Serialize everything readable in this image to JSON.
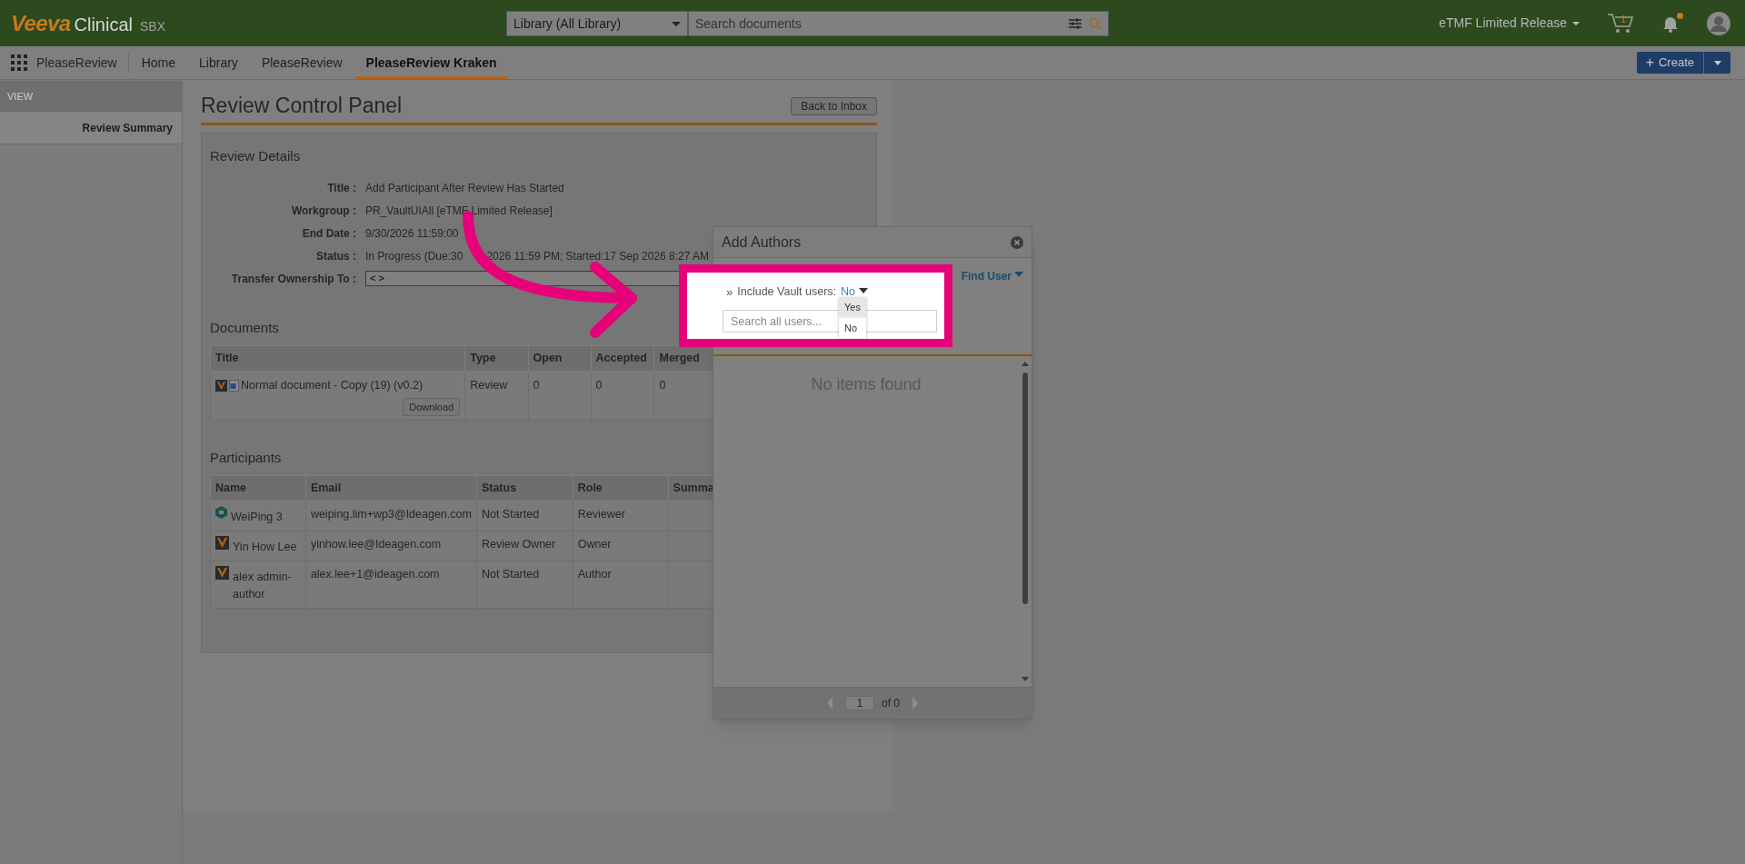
{
  "header": {
    "brand": "Veeva",
    "product": "Clinical",
    "environment": "SBX",
    "search_scope": "Library (All Library)",
    "search": {
      "placeholder": "Search documents"
    },
    "vault_name": "eTMF Limited Release",
    "cart_count": "1",
    "notification_dot": true
  },
  "nav": {
    "create_icon": "+",
    "app_name": "PleaseReview",
    "tabs": [
      {
        "label": "Home",
        "selected": false
      },
      {
        "label": "Library",
        "selected": false
      },
      {
        "label": "PleaseReview",
        "selected": false
      },
      {
        "label": "PleaseReview Kraken",
        "selected": true
      }
    ],
    "create_button": "Create"
  },
  "sidebar": {
    "heading": "VIEW",
    "items": [
      {
        "label": "Review Summary",
        "selected": true
      }
    ]
  },
  "page": {
    "title": "Review Control Panel",
    "back_button": "Back to Inbox"
  },
  "review_details": {
    "heading": "Review Details",
    "fields": [
      {
        "label": "Title :",
        "value": "Add Participant After Review Has Started",
        "kind": "text"
      },
      {
        "label": "Workgroup :",
        "value": "PR_VaultUIAll [eTMF Limited Release]",
        "kind": "text"
      },
      {
        "label": "End Date :",
        "value": "9/30/2026 11:59:00",
        "kind": "text"
      },
      {
        "label": "Status :",
        "value": "In Progress (Due:30",
        "value_after": "2026 11:59 PM; Started:17 Sep 2026 8:27 AM",
        "kind": "text"
      },
      {
        "label": "Transfer Ownership To :",
        "value": "< >",
        "kind": "select"
      }
    ]
  },
  "documents": {
    "heading": "Documents",
    "columns": [
      "Title",
      "Type",
      "Open",
      "Accepted",
      "Merged"
    ],
    "rows": [
      {
        "button": "Download",
        "cells": [
          "Normal document - Copy (19) (v0.2)",
          "Review",
          "0",
          "0",
          "0"
        ]
      }
    ]
  },
  "participants": {
    "heading": "Participants",
    "columns": [
      "Name",
      "Email",
      "Status",
      "Role",
      "Summa"
    ],
    "rows": [
      {
        "name": "WeiPing 3",
        "kind": "external",
        "email": "weiping.lim+wp3@Ideagen.com",
        "status": "Not Started",
        "role": "Reviewer"
      },
      {
        "name": "Yin How Lee",
        "kind": "vault",
        "email": "yinhow.lee@Ideagen.com",
        "status": "Review Owner",
        "role": "Owner"
      },
      {
        "name": "alex admin-author",
        "kind": "vault",
        "email": "alex.lee+1@ideagen.com",
        "status": "Not Started",
        "role": "Author"
      }
    ]
  },
  "dialog": {
    "title": "Add Authors",
    "find_user": "Find User",
    "filter_marker": "»",
    "filter_label": "Include Vault users:",
    "filter_value": "No",
    "filter_options": [
      {
        "label": "Yes",
        "highlighted": true
      },
      {
        "label": "No",
        "highlighted": false
      }
    ],
    "search": {
      "placeholder": "Search all users..."
    },
    "empty_message": "No items found",
    "page": "1",
    "page_total": "of 0"
  }
}
